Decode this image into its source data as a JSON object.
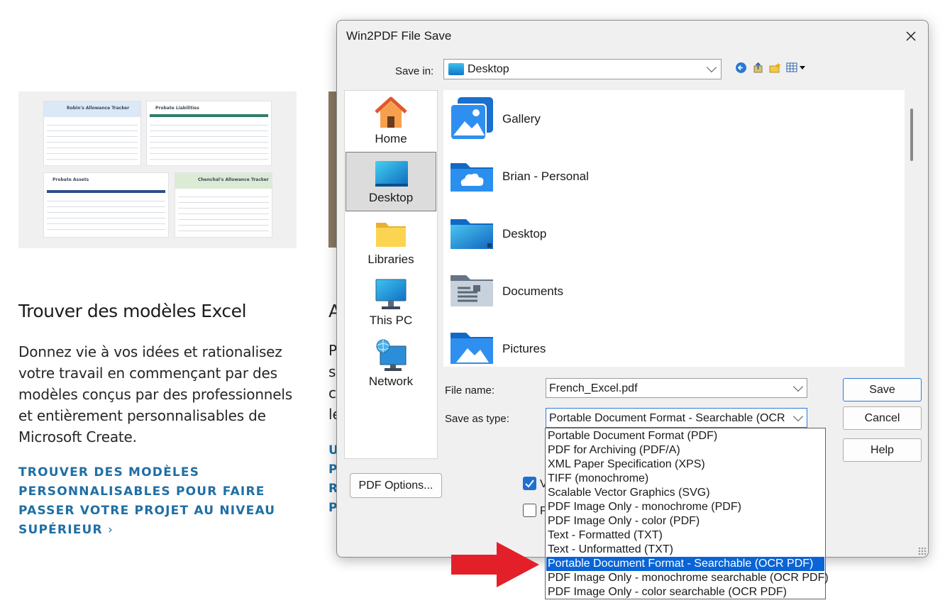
{
  "background": {
    "heading": "Trouver des modèles Excel",
    "body": "Donnez vie à vos idées et rationalisez votre travail en commençant par des modèles conçus par des professionnels et entièrement personnalisables de Microsoft Create.",
    "link": "TROUVER DES MODÈLES PERSONNALISABLES POUR FAIRE PASSER VOTRE PROJET AU NIVEAU SUPÉRIEUR",
    "link_chevron": "›",
    "cut_heading": "A",
    "cut_body": [
      "P",
      "s",
      "c",
      "le"
    ],
    "cut_link": [
      "U",
      "P",
      "R",
      "P"
    ],
    "thumbnails": [
      "Robin's Allowance Tracker",
      "Probate Liabilities",
      "Probate Assets",
      "Chenchal's Allowance Tracker"
    ]
  },
  "dialog": {
    "title": "Win2PDF File Save",
    "save_in_label": "Save in:",
    "save_in_value": "Desktop",
    "places": [
      {
        "label": "Home",
        "icon": "home-icon",
        "selected": false
      },
      {
        "label": "Desktop",
        "icon": "desktop-icon",
        "selected": true
      },
      {
        "label": "Libraries",
        "icon": "libraries-icon",
        "selected": false
      },
      {
        "label": "This PC",
        "icon": "this-pc-icon",
        "selected": false
      },
      {
        "label": "Network",
        "icon": "network-icon",
        "selected": false
      }
    ],
    "files": [
      {
        "name": "Gallery",
        "icon": "gallery-icon"
      },
      {
        "name": "Brian - Personal",
        "icon": "onedrive-folder-icon"
      },
      {
        "name": "Desktop",
        "icon": "desktop-folder-icon"
      },
      {
        "name": "Documents",
        "icon": "documents-folder-icon"
      },
      {
        "name": "Pictures",
        "icon": "pictures-folder-icon"
      }
    ],
    "file_name_label": "File name:",
    "file_name_value": "French_Excel.pdf",
    "save_as_type_label": "Save as type:",
    "save_as_type_value": "Portable Document Format - Searchable (OCR PDF)",
    "buttons": {
      "save": "Save",
      "cancel": "Cancel",
      "help": "Help",
      "pdf_options": "PDF Options..."
    },
    "checkbox1_label": "V",
    "checkbox2_label": "P",
    "type_options": [
      "Portable Document Format (PDF)",
      "PDF for Archiving (PDF/A)",
      "XML Paper Specification (XPS)",
      "TIFF (monochrome)",
      "Scalable Vector Graphics (SVG)",
      "PDF Image Only - monochrome (PDF)",
      "PDF Image Only - color (PDF)",
      "Text - Formatted (TXT)",
      "Text - Unformatted (TXT)",
      "Portable Document Format - Searchable (OCR PDF)",
      "PDF Image Only - monochrome searchable (OCR PDF)",
      "PDF Image Only - color searchable (OCR PDF)"
    ],
    "selected_option_index": 9
  },
  "colors": {
    "accent": "#0a64d6",
    "arrow": "#e3202a",
    "link": "#1f6fa4"
  }
}
